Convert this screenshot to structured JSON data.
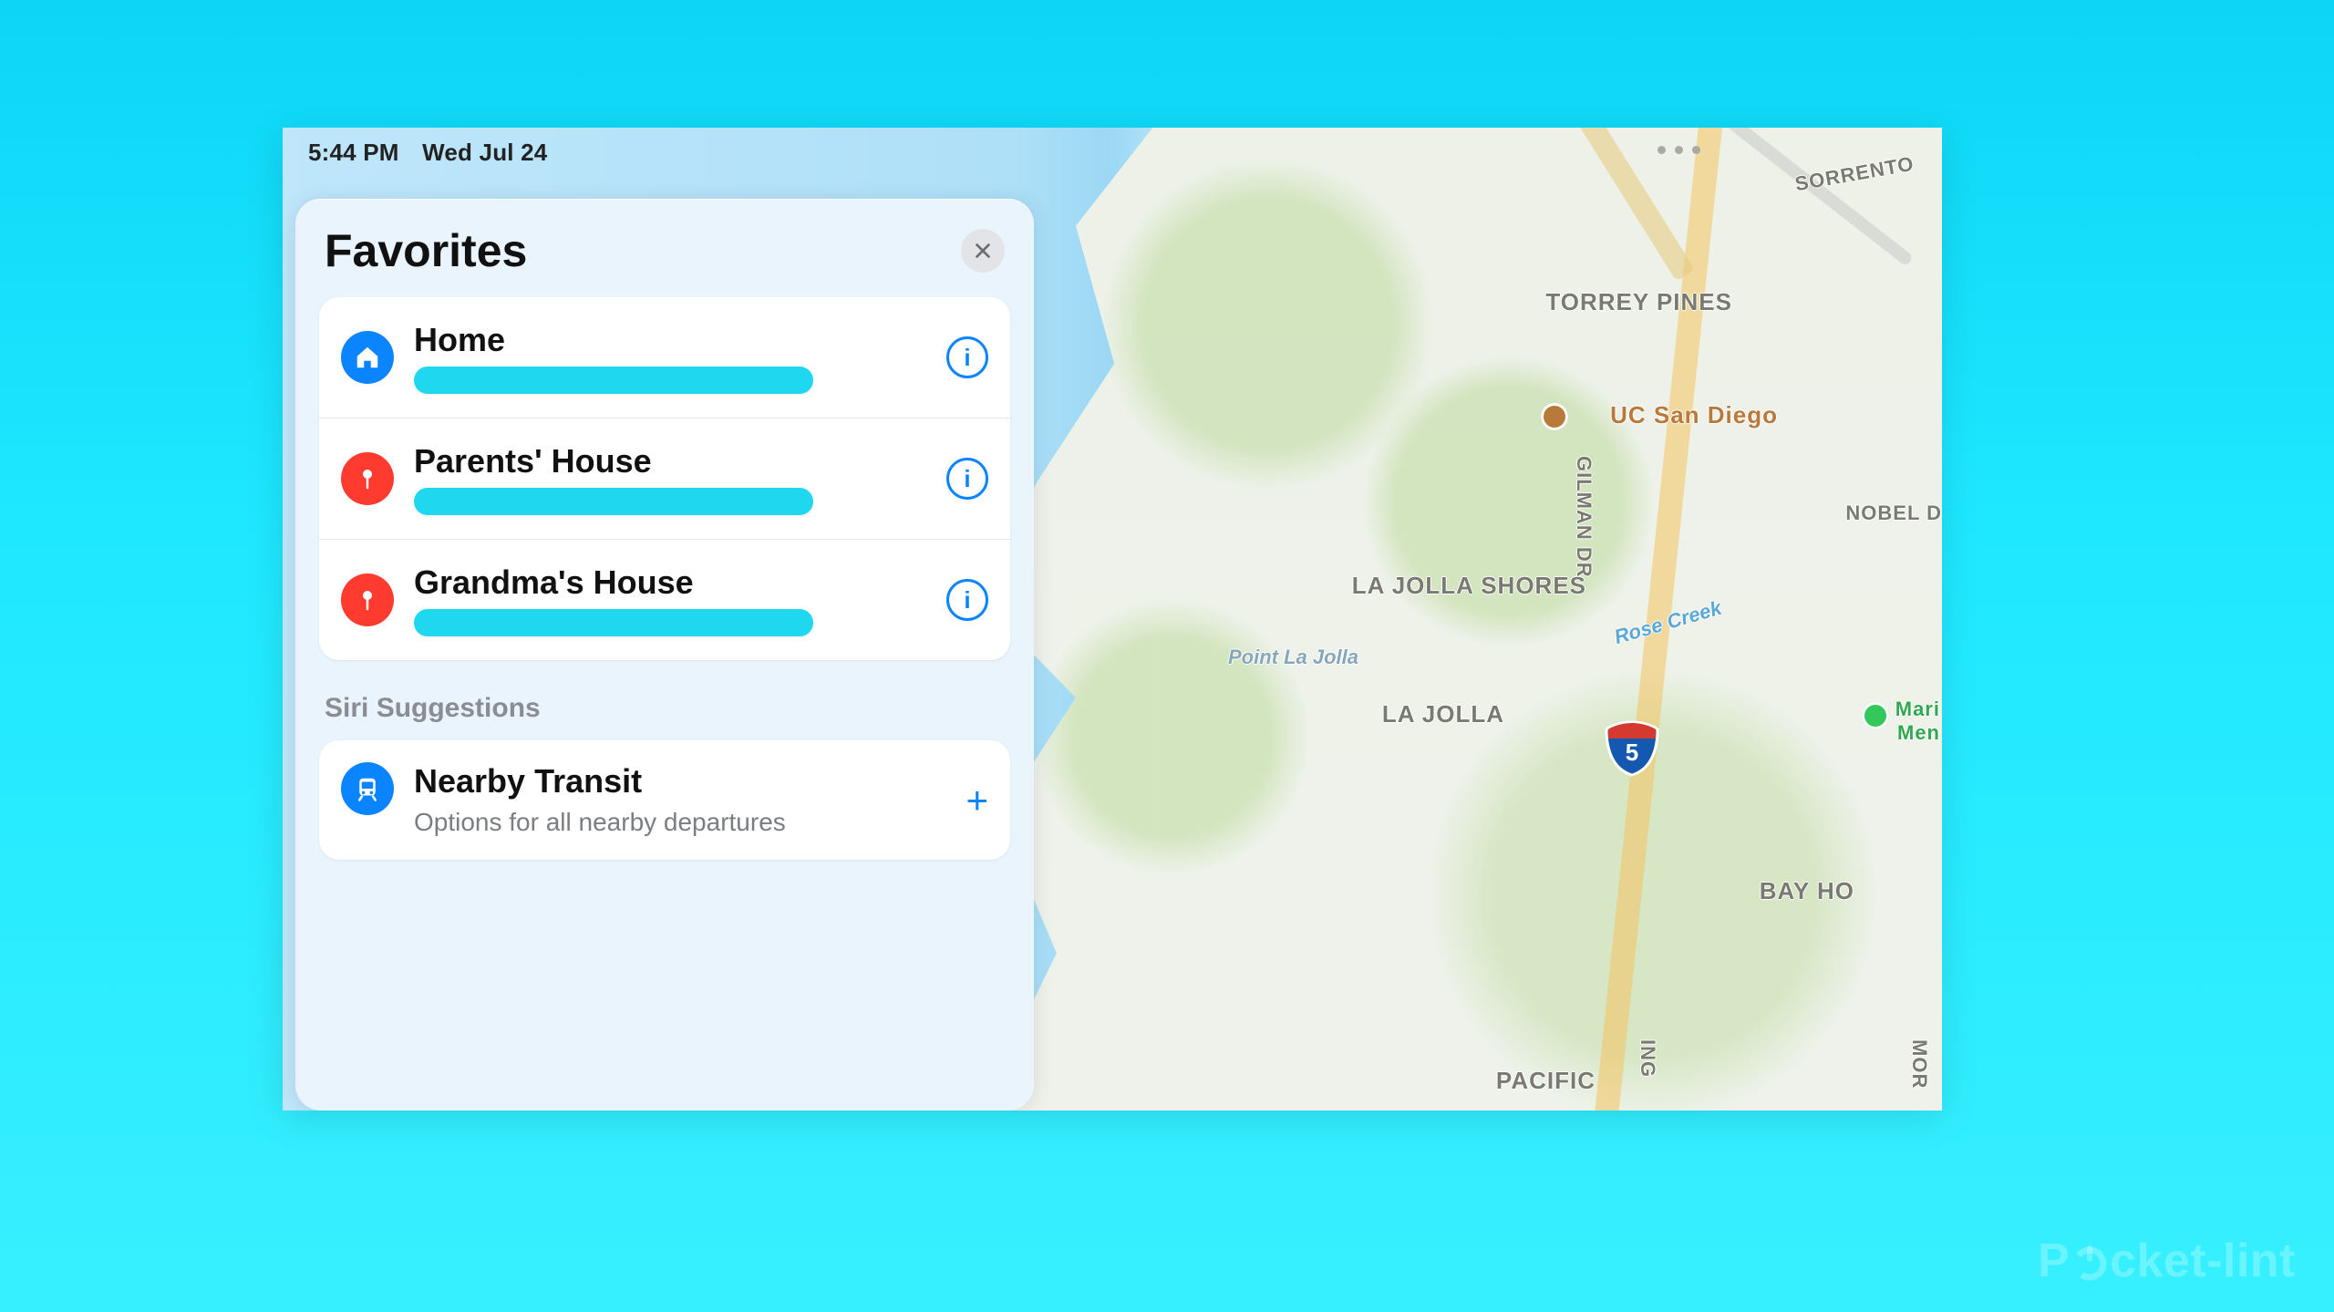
{
  "status": {
    "time": "5:44 PM",
    "date": "Wed Jul 24"
  },
  "panel": {
    "title": "Favorites",
    "favorites": [
      {
        "title": "Home",
        "icon": "home",
        "icon_color": "blue"
      },
      {
        "title": "Parents' House",
        "icon": "pin",
        "icon_color": "red"
      },
      {
        "title": "Grandma's House",
        "icon": "pin",
        "icon_color": "red"
      }
    ],
    "suggestions_heading": "Siri Suggestions",
    "suggestions": [
      {
        "title": "Nearby Transit",
        "subtitle": "Options for all nearby departures",
        "icon": "transit"
      }
    ]
  },
  "map": {
    "interstate": "5",
    "labels": {
      "sorrento": "SORRENTO",
      "torrey": "TORREY PINES",
      "uc": "UC San Diego",
      "nobel": "NOBEL D",
      "gilman": "GILMAN DR",
      "lajolla_shores": "LA JOLLA SHORES",
      "point_la_jolla": "Point La Jolla",
      "lajolla": "LA JOLLA",
      "rose_creek": "Rose Creek",
      "mari": "Mari",
      "men": "Men",
      "bayho": "BAY HO",
      "pacific": "PACIFIC",
      "ing": "ING",
      "mor": "MOR"
    }
  },
  "watermark": "Pocket-lint"
}
